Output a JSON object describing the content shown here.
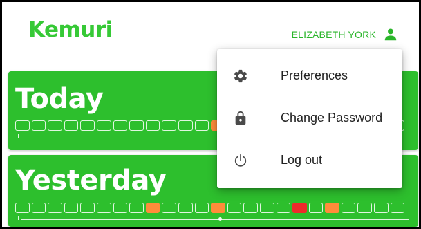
{
  "app": {
    "logo_text": "Kemuri",
    "brand_color": "#2dbf2d",
    "logo_color": "#36c936"
  },
  "header": {
    "user_name": "ELIZABETH YORK",
    "user_icon": "person-icon",
    "user_color": "#2ab52a"
  },
  "cards": [
    {
      "title": "Today",
      "cells": [
        "ok",
        "ok",
        "ok",
        "ok",
        "ok",
        "ok",
        "ok",
        "ok",
        "ok",
        "ok",
        "ok",
        "ok",
        "warn",
        "ok",
        "ok",
        "ok",
        "ok",
        "ok",
        "ok",
        "ok",
        "ok",
        "ok",
        "ok",
        "ok"
      ]
    },
    {
      "title": "Yesterday",
      "cells": [
        "ok",
        "ok",
        "ok",
        "ok",
        "ok",
        "ok",
        "ok",
        "ok",
        "warn",
        "ok",
        "ok",
        "ok",
        "warn",
        "ok",
        "ok",
        "ok",
        "ok",
        "alert",
        "ok",
        "warn",
        "ok",
        "ok",
        "ok",
        "ok"
      ]
    }
  ],
  "status_colors": {
    "ok": "transparent",
    "warn": "#ff8c3a",
    "alert": "#ee2b2b"
  },
  "menu": {
    "items": [
      {
        "label": "Preferences",
        "icon": "gear-icon"
      },
      {
        "label": "Change Password",
        "icon": "lock-icon"
      },
      {
        "label": "Log out",
        "icon": "power-icon"
      }
    ]
  }
}
